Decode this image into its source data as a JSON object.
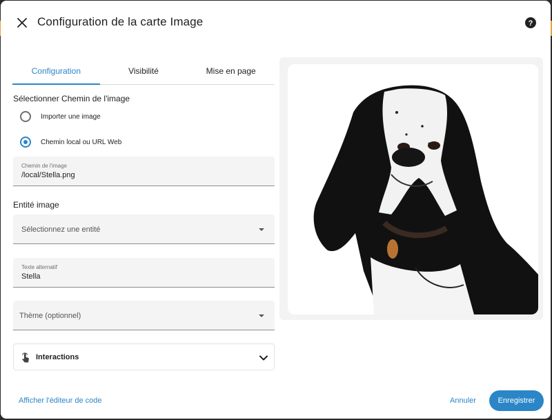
{
  "dialog": {
    "title": "Configuration de la carte Image",
    "close_icon": "close-icon",
    "help_icon": "help-circle-icon"
  },
  "tabs": [
    {
      "label": "Configuration",
      "active": true
    },
    {
      "label": "Visibilité",
      "active": false
    },
    {
      "label": "Mise en page",
      "active": false
    }
  ],
  "image_path_section": {
    "label": "Sélectionner Chemin de l'image",
    "options": [
      {
        "label": "Importer une image",
        "checked": false
      },
      {
        "label": "Chemin local ou URL Web",
        "checked": true
      }
    ],
    "path_field": {
      "label": "Chemin de l'image",
      "value": "/local/Stella.png"
    }
  },
  "entity_section": {
    "label": "Entité image",
    "select_placeholder": "Sélectionnez une entité"
  },
  "alt_text_field": {
    "label": "Texte alternatif",
    "value": "Stella"
  },
  "theme_select": {
    "placeholder": "Thème (optionnel)"
  },
  "interactions": {
    "label": "Interactions",
    "icon": "gesture-tap-icon"
  },
  "preview": {
    "subject": "dog-photo"
  },
  "footer": {
    "code_editor_link": "Afficher l'éditeur de code",
    "cancel_label": "Annuler",
    "save_label": "Enregistrer"
  },
  "colors": {
    "accent": "#2a86c7",
    "field_bg": "#f4f4f4",
    "preview_bg": "#f3f3f3"
  }
}
